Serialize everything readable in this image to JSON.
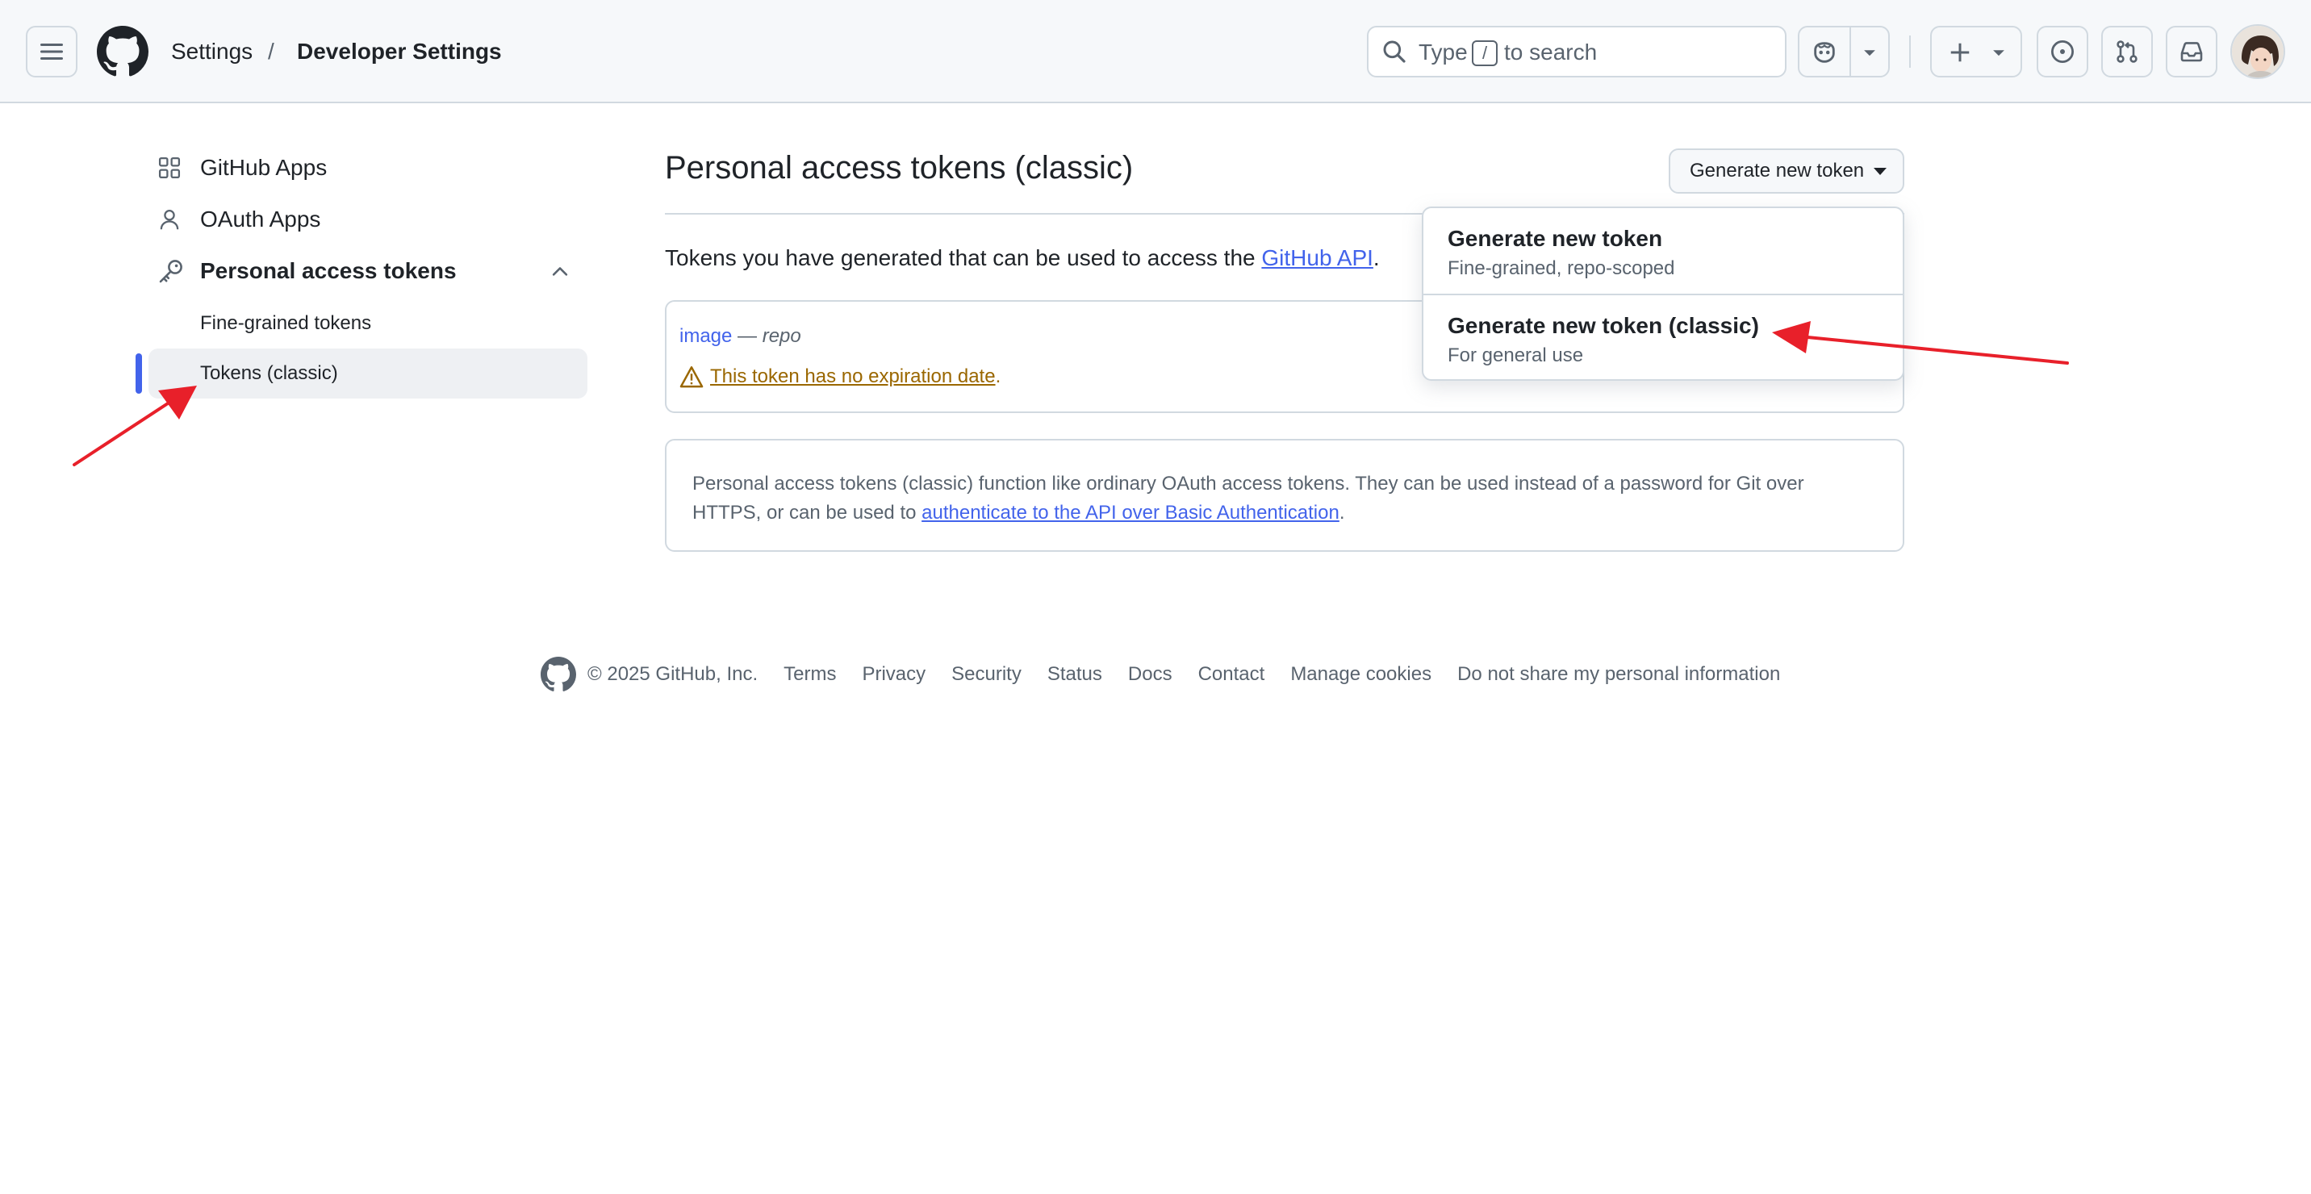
{
  "header": {
    "breadcrumb_settings": "Settings",
    "breadcrumb_separator": "/",
    "breadcrumb_current": "Developer Settings",
    "search": {
      "prefix": "Type",
      "key": "/",
      "suffix": "to search"
    }
  },
  "sidebar": {
    "items": [
      {
        "label": "GitHub Apps",
        "icon": "apps-grid-icon"
      },
      {
        "label": "OAuth Apps",
        "icon": "person-icon"
      },
      {
        "label": "Personal access tokens",
        "icon": "key-icon",
        "expanded": true
      }
    ],
    "subitems": [
      {
        "label": "Fine-grained tokens",
        "active": false
      },
      {
        "label": "Tokens (classic)",
        "active": true
      }
    ]
  },
  "main": {
    "title": "Personal access tokens (classic)",
    "generate_button": "Generate new token",
    "intro_text": "Tokens you have generated that can be used to access the ",
    "intro_link": "GitHub API",
    "intro_end": ".",
    "token": {
      "name": "image",
      "separator": "—",
      "scope": "repo",
      "warning": "This token has no expiration date",
      "warning_end": "."
    },
    "info": {
      "text": "Personal access tokens (classic) function like ordinary OAuth access tokens. They can be used instead of a password for Git over HTTPS, or can be used to ",
      "link": "authenticate to the API over Basic Authentication",
      "end": "."
    }
  },
  "dropdown": {
    "items": [
      {
        "title": "Generate new token",
        "description": "Fine-grained, repo-scoped"
      },
      {
        "title": "Generate new token (classic)",
        "description": "For general use"
      }
    ]
  },
  "footer": {
    "copyright": "© 2025 GitHub, Inc.",
    "links": [
      "Terms",
      "Privacy",
      "Security",
      "Status",
      "Docs",
      "Contact",
      "Manage cookies",
      "Do not share my personal information"
    ]
  },
  "colors": {
    "accent": "#4263eb",
    "annotation_arrow": "#e8202a",
    "warning": "#9a6700"
  }
}
